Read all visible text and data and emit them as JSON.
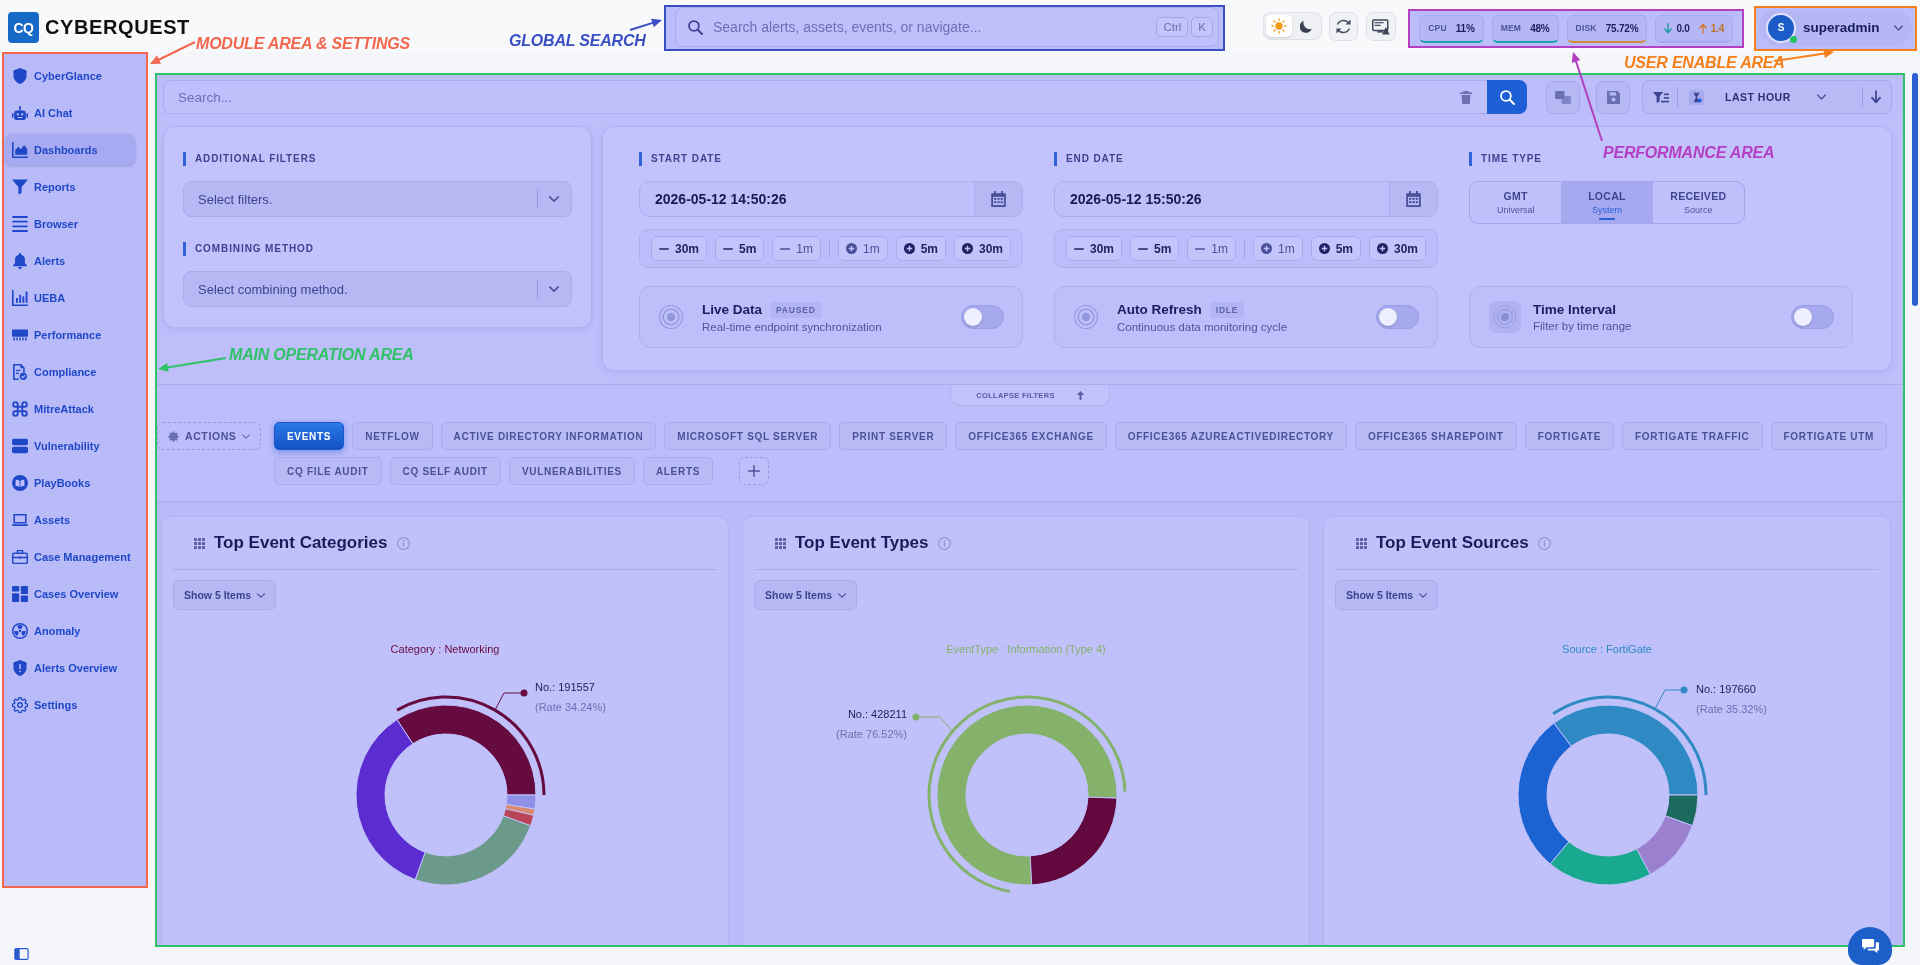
{
  "header": {
    "logo_mark": "CQ",
    "brand": "CYBERQUEST",
    "search": {
      "placeholder": "Search alerts, assets, events, or navigate...",
      "keys": [
        "Ctrl",
        "K"
      ]
    },
    "theme_modes": [
      {
        "kind": "light",
        "selected": true
      },
      {
        "kind": "dark",
        "selected": false
      }
    ],
    "metrics": [
      {
        "label": "CPU",
        "value": "11%",
        "color": "#1fa0b4"
      },
      {
        "label": "MEM",
        "value": "48%",
        "color": "#1fa0b4"
      },
      {
        "label": "DISK",
        "value": "75.72%",
        "color": "#d7873c"
      }
    ],
    "network": {
      "down": "0.0",
      "up": "1.4"
    },
    "user": {
      "initial": "S",
      "name": "superadmin",
      "online": true
    }
  },
  "sidebar": {
    "items": [
      {
        "label": "CyberGlance",
        "selected": false
      },
      {
        "label": "AI Chat",
        "selected": false
      },
      {
        "label": "Dashboards",
        "selected": true
      },
      {
        "label": "Reports",
        "selected": false
      },
      {
        "label": "Browser",
        "selected": false
      },
      {
        "label": "Alerts",
        "selected": false
      },
      {
        "label": "UEBA",
        "selected": false
      },
      {
        "label": "Performance",
        "selected": false
      },
      {
        "label": "Compliance",
        "selected": false
      },
      {
        "label": "MitreAttack",
        "selected": false
      },
      {
        "label": "Vulnerability",
        "selected": false
      },
      {
        "label": "PlayBooks",
        "selected": false
      },
      {
        "label": "Assets",
        "selected": false
      },
      {
        "label": "Case Management",
        "selected": false
      },
      {
        "label": "Cases Overview",
        "selected": false
      },
      {
        "label": "Anomaly",
        "selected": false
      },
      {
        "label": "Alerts Overview",
        "selected": false
      },
      {
        "label": "Settings",
        "selected": false
      }
    ]
  },
  "toolbar": {
    "search_placeholder": "Search...",
    "time_range": "LAST HOUR"
  },
  "filters": {
    "additional": {
      "label": "ADDITIONAL FILTERS",
      "placeholder": "Select filters."
    },
    "combining": {
      "label": "COMBINING METHOD",
      "placeholder": "Select combining method."
    },
    "start": {
      "label": "START DATE",
      "value": "2026-05-12 14:50:26",
      "steps": [
        {
          "kind": "minus",
          "label": "30m"
        },
        {
          "kind": "minus",
          "label": "5m"
        },
        {
          "kind": "minus",
          "label": "1m"
        },
        {
          "kind": "plus",
          "label": "1m"
        },
        {
          "kind": "plus",
          "label": "5m"
        },
        {
          "kind": "plus",
          "label": "30m"
        }
      ]
    },
    "end": {
      "label": "END DATE",
      "value": "2026-05-12 15:50:26",
      "steps": [
        {
          "kind": "minus",
          "label": "30m"
        },
        {
          "kind": "minus",
          "label": "5m"
        },
        {
          "kind": "minus",
          "label": "1m"
        },
        {
          "kind": "plus",
          "label": "1m"
        },
        {
          "kind": "plus",
          "label": "5m"
        },
        {
          "kind": "plus",
          "label": "30m"
        }
      ]
    },
    "time_type": {
      "label": "TIME TYPE",
      "options": [
        {
          "label": "GMT",
          "sub": "Universal",
          "selected": false
        },
        {
          "label": "LOCAL",
          "sub": "System",
          "selected": true
        },
        {
          "label": "RECEIVED",
          "sub": "Source",
          "selected": false
        }
      ]
    },
    "switches": [
      {
        "title": "Live Data",
        "badge": "PAUSED",
        "subtitle": "Real-time endpoint synchronization",
        "on": false
      },
      {
        "title": "Auto Refresh",
        "badge": "IDLE",
        "subtitle": "Continuous data monitoring cycle",
        "on": false
      },
      {
        "title": "Time Interval",
        "subtitle": "Filter by time range",
        "on": false
      }
    ],
    "collapse_label": "COLLAPSE FILTERS"
  },
  "tabs": {
    "actions_label": "ACTIONS",
    "items": [
      {
        "label": "EVENTS",
        "selected": true
      },
      {
        "label": "NETFLOW",
        "selected": false
      },
      {
        "label": "ACTIVE DIRECTORY INFORMATION",
        "selected": false
      },
      {
        "label": "MICROSOFT SQL SERVER",
        "selected": false
      },
      {
        "label": "PRINT SERVER",
        "selected": false
      },
      {
        "label": "OFFICE365 EXCHANGE",
        "selected": false
      },
      {
        "label": "OFFICE365 AZUREACTIVEDIRECTORY",
        "selected": false
      },
      {
        "label": "OFFICE365 SHAREPOINT",
        "selected": false
      },
      {
        "label": "FORTIGATE",
        "selected": false
      },
      {
        "label": "FORTIGATE TRAFFIC",
        "selected": false
      },
      {
        "label": "FORTIGATE UTM",
        "selected": false
      },
      {
        "label": "CQ FILE AUDIT",
        "selected": false
      },
      {
        "label": "CQ SELF AUDIT",
        "selected": false
      },
      {
        "label": "VULNERABILITIES",
        "selected": false
      },
      {
        "label": "ALERTS",
        "selected": false
      }
    ]
  },
  "widgets": [
    {
      "title": "Top Event Categories",
      "show_label": "Show 5 Items",
      "chart": {
        "caption": "Category : Networking",
        "color": "#650b40",
        "count": "No.: 191557",
        "rate": "(Rate 34.24%)"
      }
    },
    {
      "title": "Top Event Types",
      "show_label": "Show 5 Items",
      "chart": {
        "caption": "EventType : Information (Type 4)",
        "color": "#84b26a",
        "count": "No.: 428211",
        "rate": "(Rate 76.52%)"
      }
    },
    {
      "title": "Top Event Sources",
      "show_label": "Show 5 Items",
      "chart": {
        "caption": "Source : FortiGate",
        "color": "#2f8ac3",
        "count": "No.: 197660",
        "rate": "(Rate 35.32%)"
      }
    }
  ],
  "annotations": [
    {
      "text": "MODULE AREA & SETTINGS",
      "color": "#f2674e"
    },
    {
      "text": "GLOBAL SEARCH",
      "color": "#3b4fc4"
    },
    {
      "text": "USER ENABLE AREA",
      "color": "#f5801b"
    },
    {
      "text": "PERFORMANCE AREA",
      "color": "#b43fc2"
    },
    {
      "text": "MAIN OPERATION AREA",
      "color": "#30c266"
    }
  ]
}
